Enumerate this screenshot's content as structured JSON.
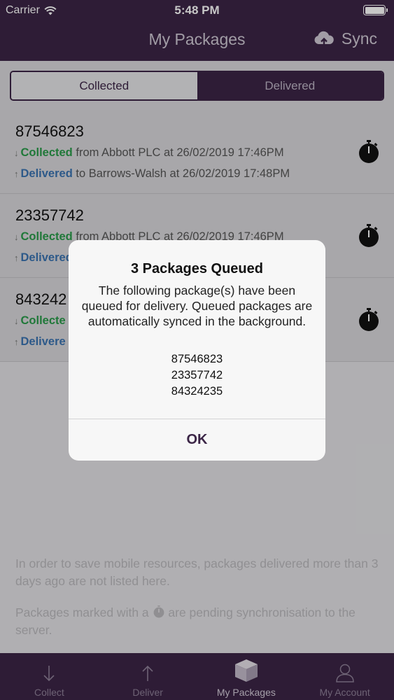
{
  "status": {
    "carrier": "Carrier",
    "time": "5:48 PM"
  },
  "nav": {
    "title": "My Packages",
    "sync_label": "Sync"
  },
  "segments": {
    "collected": "Collected",
    "delivered": "Delivered",
    "selected": "Delivered"
  },
  "packages": [
    {
      "id": "87546823",
      "collected_word": "Collected",
      "collected_rest": " from Abbott PLC at 26/02/2019 17:46PM",
      "delivered_word": "Delivered",
      "delivered_rest": " to Barrows-Walsh at 26/02/2019 17:48PM"
    },
    {
      "id": "23357742",
      "collected_word": "Collected",
      "collected_rest": " from Abbott PLC at 26/02/2019 17:46PM",
      "delivered_word": "Delivered",
      "delivered_rest": ""
    },
    {
      "id": "843242",
      "collected_word": "Collecte",
      "collected_rest": "",
      "delivered_word": "Delivere",
      "delivered_rest": ""
    }
  ],
  "notes": {
    "resources": "In order to save mobile resources, packages delivered more than 3 days ago are not listed here.",
    "pending_before": "Packages marked with a ",
    "pending_after": " are pending synchronisation to the server."
  },
  "tabs": [
    {
      "label": "Collect",
      "icon": "arrow-down-icon"
    },
    {
      "label": "Deliver",
      "icon": "arrow-up-icon"
    },
    {
      "label": "My Packages",
      "icon": "box-icon",
      "active": true
    },
    {
      "label": "My Account",
      "icon": "user-icon"
    }
  ],
  "alert": {
    "title": "3 Packages Queued",
    "message": "The following package(s) have been queued for delivery. Queued packages are automatically synced in the background.",
    "ids": [
      "87546823",
      "23357742",
      "84324235"
    ],
    "ok_label": "OK"
  },
  "colors": {
    "brand": "#3b2546",
    "collected": "#2a9a4a",
    "delivered": "#3a73b0"
  }
}
